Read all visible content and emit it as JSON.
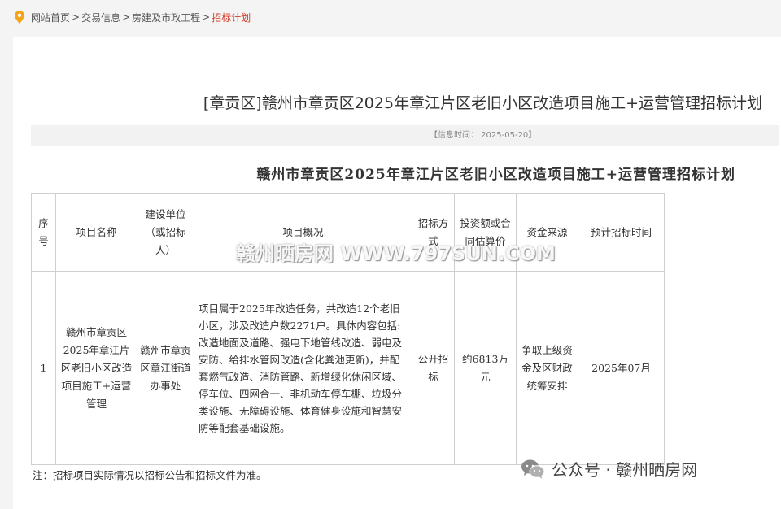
{
  "breadcrumb": {
    "items": [
      "网站首页",
      "交易信息",
      "房建及市政工程"
    ],
    "current": "招标计划",
    "separator": ">"
  },
  "article": {
    "title": "[章贡区]赣州市章贡区2025年章江片区老旧小区改造项目施工+运营管理招标计划",
    "info_time": "【信息时间： 2025-05-20】",
    "subtitle": "赣州市章贡区2025年章江片区老旧小区改造项目施工+运营管理招标计划"
  },
  "table": {
    "headers": [
      "序号",
      "项目名称",
      "建设单位（或招标人）",
      "项目概况",
      "招标方式",
      "投资额或合同估算价",
      "资金来源",
      "预计招标时间"
    ],
    "rows": [
      {
        "index": "1",
        "name": "赣州市章贡区2025年章江片区老旧小区改造项目施工+运营管理",
        "owner": "赣州市章贡区章江街道办事处",
        "summary": "项目属于2025年改造任务，共改造12个老旧小区，涉及改造户数2271户。具体内容包括:改造地面及道路、强电下地管线改造、弱电及安防、给排水管网改造(含化粪池更新)，并配套燃气改造、消防管路、新增绿化休闲区域、停车位、四网合一、非机动车停车棚、垃圾分类设施、无障碍设施、体育健身设施和智慧安防等配套基础设施。",
        "method": "公开招标",
        "amount": "约6813万元",
        "funding": "争取上级资金及区财政统筹安排",
        "time": "2025年07月"
      }
    ]
  },
  "note": "注：招标项目实际情况以招标公告和招标文件为准。",
  "watermark": "赣州晒房网 WWW.797SUN.COM",
  "official_account": "公众号 · 赣州晒房网",
  "colors": {
    "accent": "#d23c2a",
    "pin": "#f5a31a"
  }
}
